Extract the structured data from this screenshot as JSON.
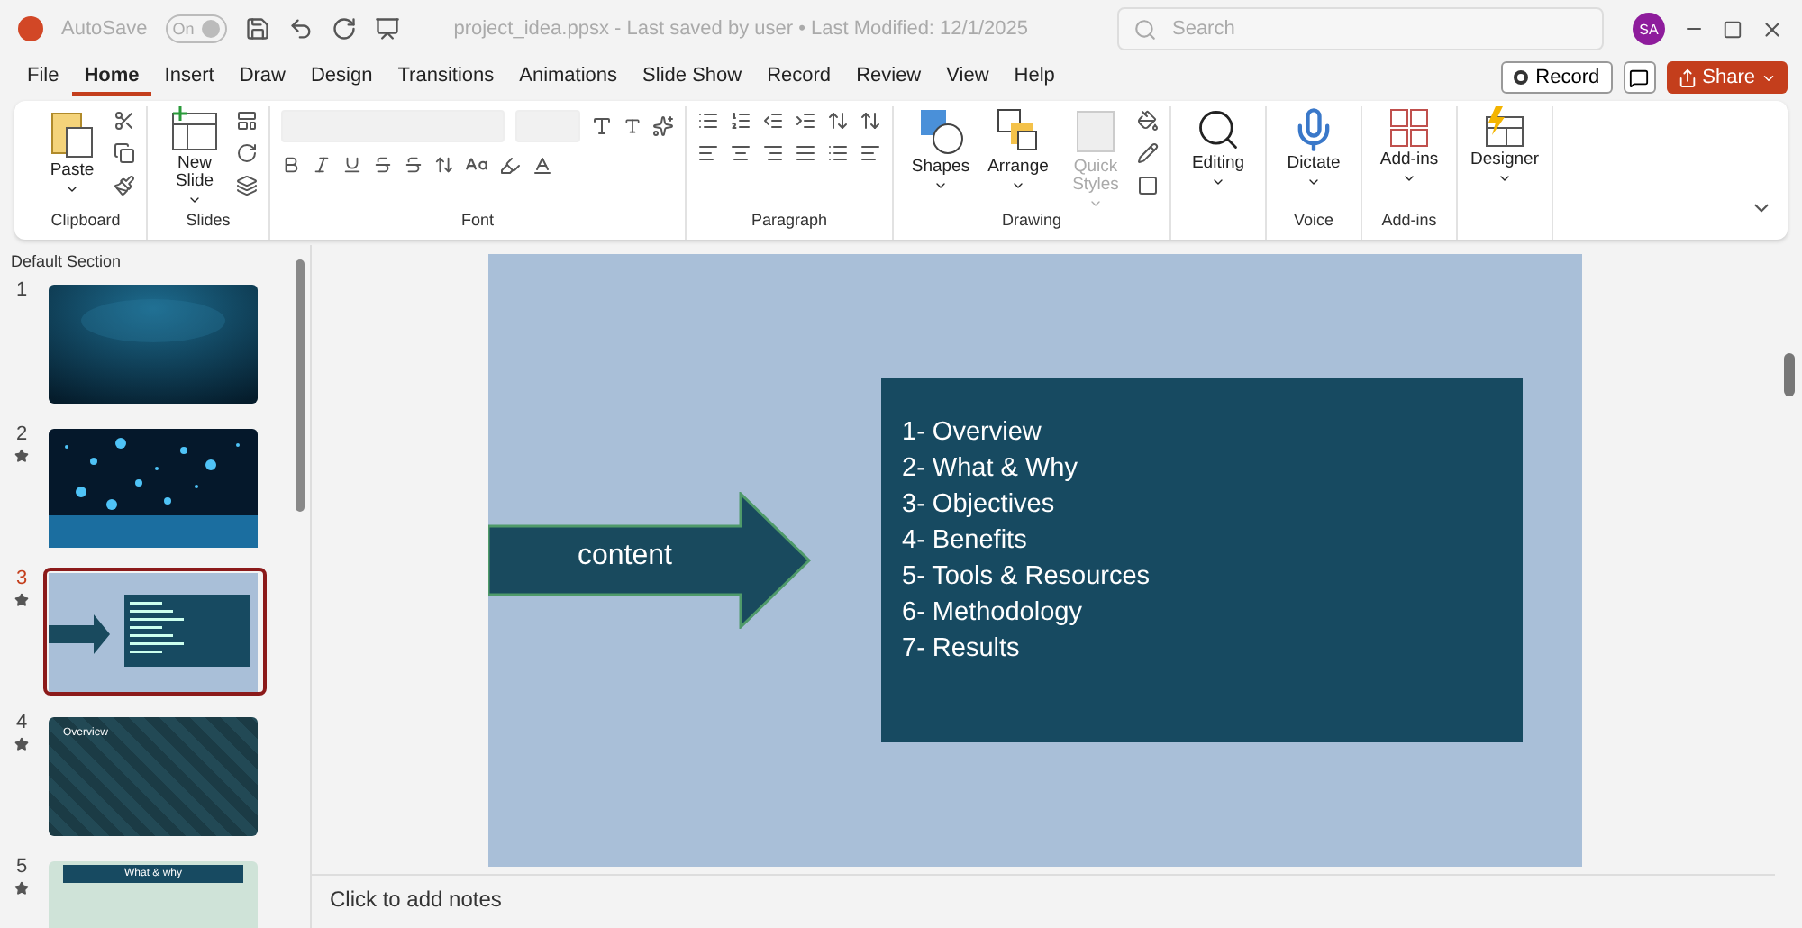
{
  "title_bar": {
    "autosave_label": "AutoSave",
    "autosave_toggle": {
      "label": "On",
      "on": true
    },
    "document": "project_idea.ppsx  -  Last saved by user  •  Last Modified: 12/1/2025",
    "search": {
      "placeholder": "Search"
    },
    "avatar": "SA"
  },
  "menu_tabs": [
    {
      "label": "File",
      "selected": false
    },
    {
      "label": "Home",
      "selected": true
    },
    {
      "label": "Insert",
      "selected": false
    },
    {
      "label": "Draw",
      "selected": false
    },
    {
      "label": "Design",
      "selected": false
    },
    {
      "label": "Transitions",
      "selected": false
    },
    {
      "label": "Animations",
      "selected": false
    },
    {
      "label": "Slide Show",
      "selected": false
    },
    {
      "label": "Record",
      "selected": false
    },
    {
      "label": "Review",
      "selected": false
    },
    {
      "label": "View",
      "selected": false
    },
    {
      "label": "Help",
      "selected": false
    }
  ],
  "actions": {
    "record": "Record",
    "share": "Share"
  },
  "ribbon_groups": [
    {
      "kind": "clipboard",
      "label": "Clipboard",
      "buttons": [
        {
          "label": "Paste",
          "disabled": false
        }
      ]
    },
    {
      "kind": "slides",
      "label": "Slides",
      "buttons": [
        {
          "label": "New Slide",
          "disabled": false
        }
      ]
    },
    {
      "kind": "font",
      "label": "Font"
    },
    {
      "kind": "paragraph",
      "label": "Paragraph"
    },
    {
      "kind": "drawing",
      "label": "Drawing",
      "buttons": [
        {
          "label": "Shapes",
          "disabled": false
        },
        {
          "label": "Arrange",
          "disabled": false
        },
        {
          "label": "Quick Styles",
          "disabled": true
        }
      ]
    },
    {
      "kind": "editing",
      "buttons": [
        {
          "label": "Editing",
          "disabled": false
        }
      ]
    },
    {
      "kind": "voice",
      "label": "Voice",
      "buttons": [
        {
          "label": "Dictate",
          "disabled": false
        }
      ]
    },
    {
      "kind": "addins",
      "label": "Add-ins",
      "buttons": [
        {
          "label": "Add-ins",
          "disabled": false
        }
      ]
    },
    {
      "kind": "designer",
      "buttons": [
        {
          "label": "Designer",
          "disabled": false
        }
      ]
    }
  ],
  "slides_panel": {
    "section": "Default Section",
    "slides": [
      {
        "number": "1",
        "starred": false,
        "selected": false,
        "kind": "dark"
      },
      {
        "number": "2",
        "starred": true,
        "selected": false,
        "kind": "bokeh"
      },
      {
        "number": "3",
        "starred": true,
        "selected": true,
        "kind": "agenda"
      },
      {
        "number": "4",
        "starred": true,
        "selected": false,
        "kind": "pattern",
        "title": "Overview"
      },
      {
        "number": "5",
        "starred": true,
        "selected": false,
        "kind": "banner",
        "title": "What & why"
      }
    ]
  },
  "slide": {
    "arrow_label": "content",
    "items": [
      "1- Overview",
      "2- What & Why",
      "3- Objectives",
      "4- Benefits",
      "5- Tools & Resources",
      "6- Methodology",
      "7- Results"
    ]
  },
  "notes": {
    "placeholder": "Click to add notes"
  }
}
